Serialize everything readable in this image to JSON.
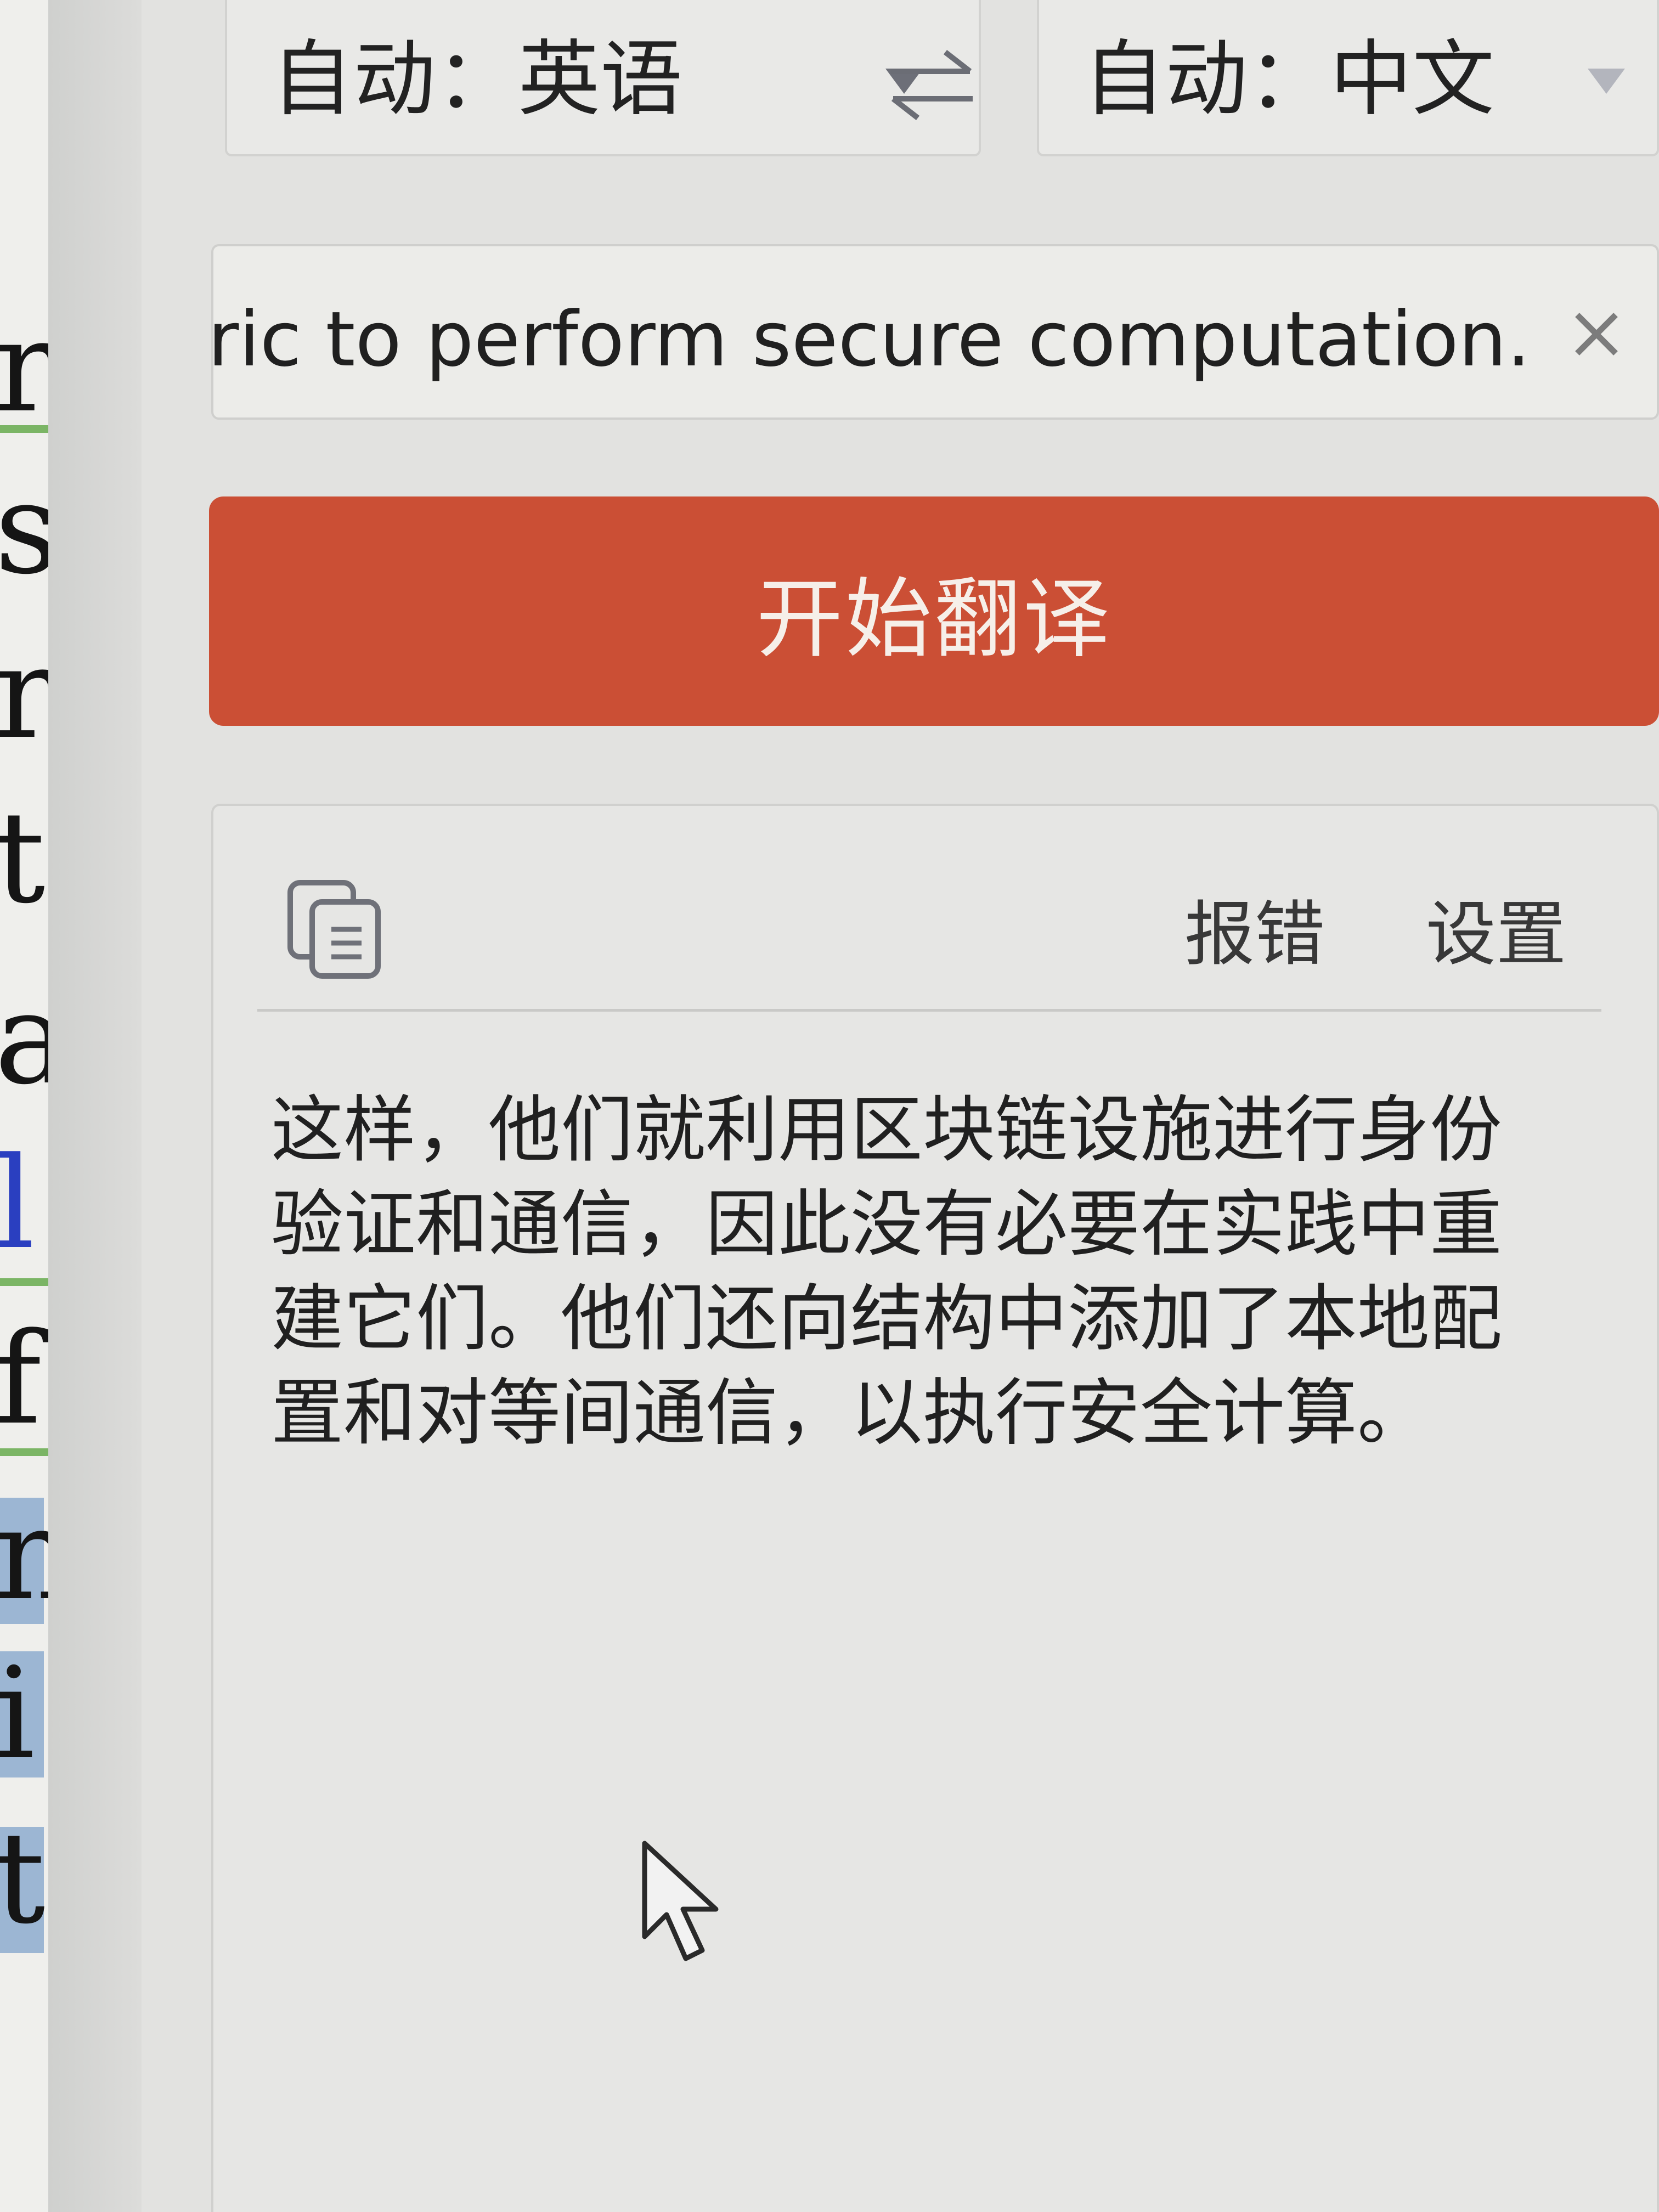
{
  "source_language": {
    "label": "自动：英语"
  },
  "target_language": {
    "label": "自动：中文"
  },
  "swap_icon": "swap-arrows-icon",
  "input": {
    "value": "ɔric to perform secure computation."
  },
  "clear_icon": "close-icon",
  "translate_button": {
    "label": "开始翻译"
  },
  "result": {
    "copy_icon": "copy-icon",
    "report_label": "报错",
    "settings_label": "设置",
    "lines": [
      "这样，他们就利用区块链设施进行身份",
      "验证和通信，因此没有必要在实践中重",
      "建它们。他们还向结构中添加了本地配",
      "置和对等间通信，以执行安全计算。"
    ]
  },
  "document_fragments": [
    "r",
    "s",
    "r",
    "t",
    "a",
    "l",
    "f",
    "n",
    "i",
    "t"
  ],
  "colors": {
    "accent_button": "#cb4f35",
    "link_blue": "#2a3fc0",
    "highlight": "#9cb6d3",
    "underline_green": "#7bb565"
  }
}
